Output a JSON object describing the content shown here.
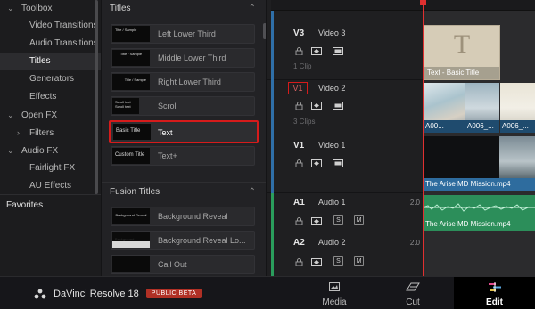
{
  "toolbox": {
    "items": [
      {
        "label": "Toolbox",
        "chevron": "v"
      },
      {
        "label": "Video Transitions"
      },
      {
        "label": "Audio Transitions"
      },
      {
        "label": "Titles"
      },
      {
        "label": "Generators"
      },
      {
        "label": "Effects"
      },
      {
        "label": "Open FX",
        "chevron": "v"
      },
      {
        "label": "Filters",
        "chevron": ">"
      },
      {
        "label": "Audio FX",
        "chevron": "v"
      },
      {
        "label": "Fairlight FX"
      },
      {
        "label": "AU Effects"
      }
    ],
    "favorites": "Favorites"
  },
  "titles_panel": {
    "section_titles": "Titles",
    "section_fusion": "Fusion Titles",
    "titles": [
      {
        "label": "Left Lower Third",
        "thumb": "Title / Sample"
      },
      {
        "label": "Middle Lower Third",
        "thumb": "Title / Sample"
      },
      {
        "label": "Right Lower Third",
        "thumb": "Title / Sample"
      },
      {
        "label": "Scroll",
        "thumb": "Scroll text Scroll text"
      },
      {
        "label": "Text",
        "thumb": "Basic Title"
      },
      {
        "label": "Text+",
        "thumb": "Custom Title"
      }
    ],
    "fusion_titles": [
      {
        "label": "Background Reveal",
        "thumb": "Background Reveal"
      },
      {
        "label": "Background Reveal Lo...",
        "thumb": "Background"
      },
      {
        "label": "Call Out",
        "thumb": ""
      }
    ]
  },
  "tracks": {
    "video": [
      {
        "code": "V3",
        "name": "Video 3",
        "clips": "1 Clip"
      },
      {
        "code": "V1",
        "name": "Video 2",
        "clips": "3 Clips"
      },
      {
        "code": "V1",
        "name": "Video 1",
        "clips": ""
      }
    ],
    "audio": [
      {
        "code": "A1",
        "name": "Audio 1",
        "level": "2.0"
      },
      {
        "code": "A2",
        "name": "Audio 2",
        "level": "2.0"
      }
    ],
    "solo_label": "S",
    "mute_label": "M"
  },
  "clips": {
    "title_clip_glyph": "T",
    "title_clip": "Text - Basic Title",
    "v2_clips": [
      "A00...",
      "A006_...",
      "A006_..."
    ],
    "v1_clip": "The Arise MD Mission.mp4",
    "a1_clip": "The Arise MD Mission.mp4"
  },
  "bottom_bar": {
    "app_name": "DaVinci Resolve 18",
    "beta_badge": "PUBLIC BETA",
    "pages": [
      {
        "label": "Media"
      },
      {
        "label": "Cut"
      },
      {
        "label": "Edit"
      }
    ]
  },
  "colors": {
    "selection": "#d61b1b",
    "video_track": "#2f6fa8",
    "audio_track": "#2a9d5c",
    "playhead": "#e03030",
    "beta_badge": "#b03025"
  }
}
